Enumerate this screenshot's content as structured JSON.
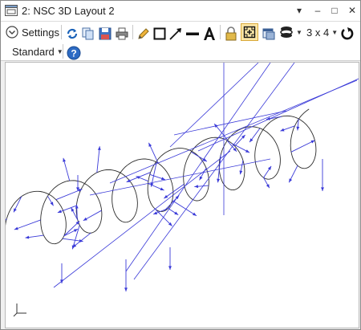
{
  "window": {
    "title": "2: NSC 3D Layout 2",
    "controls": {
      "menu": "▾",
      "minimize": "–",
      "maximize": "□",
      "close": "✕"
    }
  },
  "toolbar": {
    "settings_label": "Settings",
    "layout_label": "3 x 4",
    "icons": [
      "refresh-icon",
      "copy-icon",
      "save-icon",
      "print-icon",
      "pencil-icon",
      "rectangle-icon",
      "arrow-icon",
      "line-icon",
      "text-icon",
      "lock-icon",
      "fit-icon",
      "window-icon",
      "layers-icon",
      "rotate-icon"
    ]
  },
  "toolbar2": {
    "standard_label": "Standard",
    "help_icon": "help-icon"
  },
  "colors": {
    "rays": "#3a3ad8",
    "geometry": "#2b2b2b",
    "accent": "#1b62b8"
  }
}
